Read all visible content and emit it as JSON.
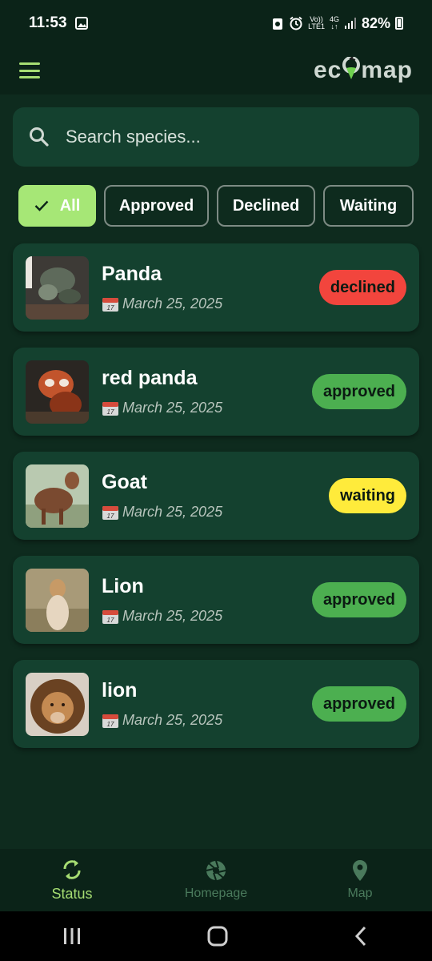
{
  "status_bar": {
    "time": "11:53",
    "volte_top": "Vo))",
    "volte_bottom": "LTE1",
    "network_top": "4G",
    "network_bottom": "↓↑",
    "battery": "82%"
  },
  "app_bar": {
    "logo_left": "ec",
    "logo_right": "map"
  },
  "search": {
    "placeholder": "Search species..."
  },
  "filters": [
    {
      "label": "All",
      "active": true
    },
    {
      "label": "Approved",
      "active": false
    },
    {
      "label": "Declined",
      "active": false
    },
    {
      "label": "Waiting",
      "active": false
    }
  ],
  "species": [
    {
      "name": "Panda",
      "date": "March 25, 2025",
      "status": "declined"
    },
    {
      "name": "red panda",
      "date": "March 25, 2025",
      "status": "approved"
    },
    {
      "name": "Goat",
      "date": "March 25, 2025",
      "status": "waiting"
    },
    {
      "name": "Lion",
      "date": "March 25, 2025",
      "status": "approved"
    },
    {
      "name": "lion",
      "date": "March 25, 2025",
      "status": "approved"
    }
  ],
  "status_colors": {
    "declined": "#f2453d",
    "approved": "#4caf50",
    "waiting": "#ffeb3b"
  },
  "bottom_nav": [
    {
      "label": "Status",
      "icon": "sync-icon",
      "active": true
    },
    {
      "label": "Homepage",
      "icon": "aperture-icon",
      "active": false
    },
    {
      "label": "Map",
      "icon": "map-pin-icon",
      "active": false
    }
  ],
  "colors": {
    "background": "#0b2318",
    "card": "#14412f",
    "accent": "#a6e776"
  }
}
